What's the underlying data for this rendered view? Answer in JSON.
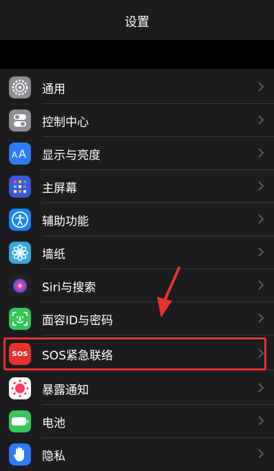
{
  "header": {
    "title": "设置"
  },
  "settings": {
    "items": [
      {
        "label": "通用",
        "icon": "gear-icon",
        "color": "#8e8e93"
      },
      {
        "label": "控制中心",
        "icon": "toggles-icon",
        "color": "#8e8e93"
      },
      {
        "label": "显示与亮度",
        "icon": "text-size-icon",
        "color": "#2f7cf6"
      },
      {
        "label": "主屏幕",
        "icon": "home-grid-icon",
        "color": "#3a5bd9"
      },
      {
        "label": "辅助功能",
        "icon": "accessibility-icon",
        "color": "#1a84ff"
      },
      {
        "label": "墙纸",
        "icon": "flower-icon",
        "color": "#36aadc"
      },
      {
        "label": "Siri与搜索",
        "icon": "siri-icon",
        "color": "#222"
      },
      {
        "label": "面容ID与密码",
        "icon": "face-id-icon",
        "color": "#34c759"
      },
      {
        "label": "SOS紧急联络",
        "icon": "sos-icon",
        "color": "#e8322b",
        "icon_text": "SOS"
      },
      {
        "label": "暴露通知",
        "icon": "exposure-icon",
        "color": "#ffffff"
      },
      {
        "label": "电池",
        "icon": "battery-icon",
        "color": "#34c759"
      },
      {
        "label": "隐私",
        "icon": "hand-icon",
        "color": "#2f7cf6"
      }
    ]
  },
  "annotation": {
    "highlighted_item": "SOS紧急联络",
    "highlight_color": "#e8322b"
  }
}
